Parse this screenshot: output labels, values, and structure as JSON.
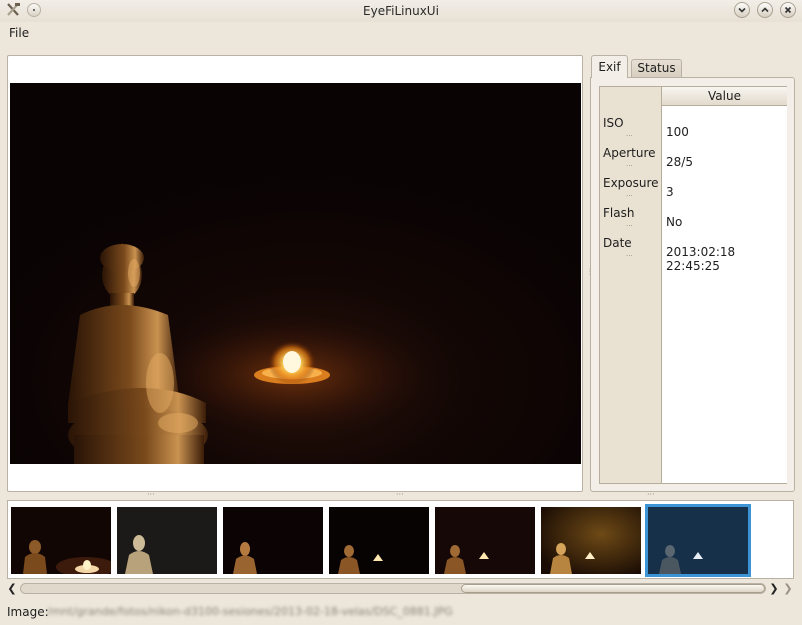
{
  "window": {
    "title": "EyeFiLinuxUi"
  },
  "menubar": {
    "file_label": "File"
  },
  "tabs": [
    {
      "label": "Exif"
    },
    {
      "label": "Status"
    }
  ],
  "exif": {
    "column_header": "Value",
    "rows": [
      {
        "name": "ISO",
        "value": "100"
      },
      {
        "name": "Aperture",
        "value": "28/5"
      },
      {
        "name": "Exposure",
        "value": "3"
      },
      {
        "name": "Flash",
        "value": "No"
      },
      {
        "name": "Date",
        "value": "2013:02:18 22:45:25"
      }
    ],
    "row_separator": "..."
  },
  "thumbnails": {
    "count": 7,
    "selected_index": 6
  },
  "statusbar": {
    "label": "Image:",
    "path": "/mnt/grande/fotos/nikon-d3100-sesiones/2013-02-18-velas/DSC_0881.JPG"
  },
  "colors": {
    "selection": "#3c94d4",
    "window_bg": "#ece6db"
  }
}
